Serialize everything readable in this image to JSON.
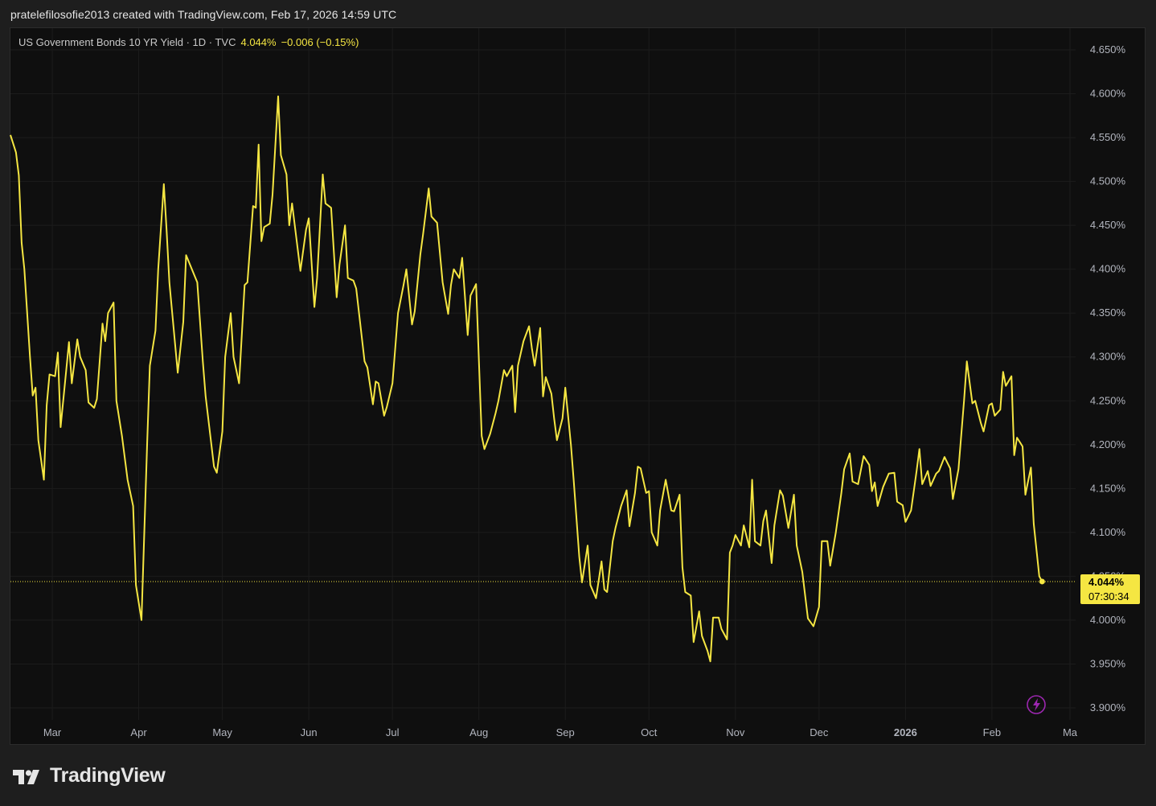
{
  "header": {
    "title": "pratelefilosofie2013 created with TradingView.com, Feb 17, 2026 14:59 UTC"
  },
  "legend": {
    "symbol": "US Government Bonds 10 YR Yield · 1D · TVC",
    "last": "4.044%",
    "change": "−0.006 (−0.15%)"
  },
  "price_label": {
    "value": "4.044%",
    "countdown": "07:30:34"
  },
  "footer": {
    "brand": "TradingView"
  },
  "colors": {
    "line": "#f5e642",
    "background": "#0f0f0f",
    "grid": "#1c1c1c",
    "label_bg": "#f5e642",
    "lightning": "#9c27b0"
  },
  "icons": {
    "lightning": "lightning-icon",
    "logo": "tradingview-logo-icon"
  },
  "chart_data": {
    "type": "line",
    "title": "US Government Bonds 10 YR Yield · 1D · TVC",
    "xlabel": "",
    "ylabel": "",
    "ylim": [
      3.88,
      4.66
    ],
    "y_ticks": [
      "4.650%",
      "4.600%",
      "4.550%",
      "4.500%",
      "4.450%",
      "4.400%",
      "4.350%",
      "4.300%",
      "4.250%",
      "4.200%",
      "4.150%",
      "4.100%",
      "4.050%",
      "4.000%",
      "3.950%",
      "3.900%"
    ],
    "y_tick_values": [
      4.65,
      4.6,
      4.55,
      4.5,
      4.45,
      4.4,
      4.35,
      4.3,
      4.25,
      4.2,
      4.15,
      4.1,
      4.05,
      4.0,
      3.95,
      3.9
    ],
    "x_ticks": [
      {
        "label": "Mar",
        "date": "2025-03-01",
        "bold": false
      },
      {
        "label": "Apr",
        "date": "2025-04-01",
        "bold": false
      },
      {
        "label": "May",
        "date": "2025-05-01",
        "bold": false
      },
      {
        "label": "Jun",
        "date": "2025-06-01",
        "bold": false
      },
      {
        "label": "Jul",
        "date": "2025-07-01",
        "bold": false
      },
      {
        "label": "Aug",
        "date": "2025-08-01",
        "bold": false
      },
      {
        "label": "Sep",
        "date": "2025-09-01",
        "bold": false
      },
      {
        "label": "Oct",
        "date": "2025-10-01",
        "bold": false
      },
      {
        "label": "Nov",
        "date": "2025-11-01",
        "bold": false
      },
      {
        "label": "Dec",
        "date": "2025-12-01",
        "bold": false
      },
      {
        "label": "2026",
        "date": "2026-01-01",
        "bold": true
      },
      {
        "label": "Feb",
        "date": "2026-02-01",
        "bold": false
      },
      {
        "label": "Ma",
        "date": "2026-03-01",
        "bold": false
      }
    ],
    "x_range": [
      "2025-02-14",
      "2026-03-01"
    ],
    "last_value": 4.044,
    "series": [
      {
        "values": [
          [
            "2025-02-14",
            4.553
          ],
          [
            "2025-02-16",
            4.533
          ],
          [
            "2025-02-17",
            4.507
          ],
          [
            "2025-02-18",
            4.43
          ],
          [
            "2025-02-19",
            4.4
          ],
          [
            "2025-02-21",
            4.3
          ],
          [
            "2025-02-22",
            4.256
          ],
          [
            "2025-02-23",
            4.265
          ],
          [
            "2025-02-24",
            4.205
          ],
          [
            "2025-02-26",
            4.16
          ],
          [
            "2025-02-27",
            4.245
          ],
          [
            "2025-02-28",
            4.28
          ],
          [
            "2025-03-02",
            4.278
          ],
          [
            "2025-03-03",
            4.305
          ],
          [
            "2025-03-04",
            4.22
          ],
          [
            "2025-03-06",
            4.285
          ],
          [
            "2025-03-07",
            4.317
          ],
          [
            "2025-03-08",
            4.27
          ],
          [
            "2025-03-10",
            4.32
          ],
          [
            "2025-03-11",
            4.3
          ],
          [
            "2025-03-13",
            4.285
          ],
          [
            "2025-03-14",
            4.248
          ],
          [
            "2025-03-16",
            4.242
          ],
          [
            "2025-03-17",
            4.252
          ],
          [
            "2025-03-19",
            4.338
          ],
          [
            "2025-03-20",
            4.318
          ],
          [
            "2025-03-21",
            4.35
          ],
          [
            "2025-03-23",
            4.362
          ],
          [
            "2025-03-24",
            4.25
          ],
          [
            "2025-03-26",
            4.21
          ],
          [
            "2025-03-28",
            4.16
          ],
          [
            "2025-03-30",
            4.13
          ],
          [
            "2025-03-31",
            4.04
          ],
          [
            "2025-04-02",
            4.0
          ],
          [
            "2025-04-04",
            4.2
          ],
          [
            "2025-04-05",
            4.29
          ],
          [
            "2025-04-07",
            4.33
          ],
          [
            "2025-04-08",
            4.4
          ],
          [
            "2025-04-10",
            4.497
          ],
          [
            "2025-04-11",
            4.445
          ],
          [
            "2025-04-12",
            4.385
          ],
          [
            "2025-04-15",
            4.282
          ],
          [
            "2025-04-17",
            4.34
          ],
          [
            "2025-04-18",
            4.416
          ],
          [
            "2025-04-22",
            4.385
          ],
          [
            "2025-04-24",
            4.295
          ],
          [
            "2025-04-25",
            4.255
          ],
          [
            "2025-04-28",
            4.175
          ],
          [
            "2025-04-29",
            4.168
          ],
          [
            "2025-05-01",
            4.215
          ],
          [
            "2025-05-02",
            4.3
          ],
          [
            "2025-05-04",
            4.35
          ],
          [
            "2025-05-05",
            4.3
          ],
          [
            "2025-05-07",
            4.27
          ],
          [
            "2025-05-09",
            4.382
          ],
          [
            "2025-05-10",
            4.385
          ],
          [
            "2025-05-12",
            4.472
          ],
          [
            "2025-05-13",
            4.47
          ],
          [
            "2025-05-14",
            4.542
          ],
          [
            "2025-05-15",
            4.432
          ],
          [
            "2025-05-16",
            4.448
          ],
          [
            "2025-05-18",
            4.452
          ],
          [
            "2025-05-19",
            4.485
          ],
          [
            "2025-05-21",
            4.597
          ],
          [
            "2025-05-22",
            4.53
          ],
          [
            "2025-05-24",
            4.508
          ],
          [
            "2025-05-25",
            4.45
          ],
          [
            "2025-05-26",
            4.475
          ],
          [
            "2025-05-29",
            4.398
          ],
          [
            "2025-05-31",
            4.445
          ],
          [
            "2025-06-01",
            4.458
          ],
          [
            "2025-06-03",
            4.357
          ],
          [
            "2025-06-04",
            4.39
          ],
          [
            "2025-06-06",
            4.508
          ],
          [
            "2025-06-07",
            4.475
          ],
          [
            "2025-06-09",
            4.47
          ],
          [
            "2025-06-11",
            4.368
          ],
          [
            "2025-06-12",
            4.405
          ],
          [
            "2025-06-14",
            4.45
          ],
          [
            "2025-06-15",
            4.39
          ],
          [
            "2025-06-17",
            4.387
          ],
          [
            "2025-06-18",
            4.378
          ],
          [
            "2025-06-21",
            4.295
          ],
          [
            "2025-06-22",
            4.288
          ],
          [
            "2025-06-24",
            4.246
          ],
          [
            "2025-06-25",
            4.272
          ],
          [
            "2025-06-26",
            4.27
          ],
          [
            "2025-06-28",
            4.233
          ],
          [
            "2025-06-29",
            4.243
          ],
          [
            "2025-07-01",
            4.27
          ],
          [
            "2025-07-03",
            4.35
          ],
          [
            "2025-07-05",
            4.382
          ],
          [
            "2025-07-06",
            4.4
          ],
          [
            "2025-07-08",
            4.337
          ],
          [
            "2025-07-09",
            4.352
          ],
          [
            "2025-07-11",
            4.417
          ],
          [
            "2025-07-12",
            4.44
          ],
          [
            "2025-07-14",
            4.492
          ],
          [
            "2025-07-15",
            4.46
          ],
          [
            "2025-07-17",
            4.453
          ],
          [
            "2025-07-19",
            4.385
          ],
          [
            "2025-07-21",
            4.349
          ],
          [
            "2025-07-22",
            4.382
          ],
          [
            "2025-07-23",
            4.4
          ],
          [
            "2025-07-25",
            4.39
          ],
          [
            "2025-07-26",
            4.413
          ],
          [
            "2025-07-28",
            4.325
          ],
          [
            "2025-07-29",
            4.37
          ],
          [
            "2025-07-31",
            4.383
          ],
          [
            "2025-08-02",
            4.21
          ],
          [
            "2025-08-03",
            4.195
          ],
          [
            "2025-08-05",
            4.212
          ],
          [
            "2025-08-07",
            4.236
          ],
          [
            "2025-08-08",
            4.25
          ],
          [
            "2025-08-10",
            4.285
          ],
          [
            "2025-08-11",
            4.278
          ],
          [
            "2025-08-13",
            4.29
          ],
          [
            "2025-08-14",
            4.237
          ],
          [
            "2025-08-15",
            4.29
          ],
          [
            "2025-08-17",
            4.318
          ],
          [
            "2025-08-19",
            4.335
          ],
          [
            "2025-08-20",
            4.31
          ],
          [
            "2025-08-21",
            4.29
          ],
          [
            "2025-08-23",
            4.333
          ],
          [
            "2025-08-24",
            4.255
          ],
          [
            "2025-08-25",
            4.277
          ],
          [
            "2025-08-27",
            4.258
          ],
          [
            "2025-08-28",
            4.23
          ],
          [
            "2025-08-29",
            4.205
          ],
          [
            "2025-08-31",
            4.23
          ],
          [
            "2025-09-01",
            4.265
          ],
          [
            "2025-09-03",
            4.2
          ],
          [
            "2025-09-04",
            4.16
          ],
          [
            "2025-09-06",
            4.072
          ],
          [
            "2025-09-07",
            4.043
          ],
          [
            "2025-09-09",
            4.085
          ],
          [
            "2025-09-10",
            4.04
          ],
          [
            "2025-09-12",
            4.025
          ],
          [
            "2025-09-14",
            4.067
          ],
          [
            "2025-09-15",
            4.035
          ],
          [
            "2025-09-16",
            4.032
          ],
          [
            "2025-09-18",
            4.09
          ],
          [
            "2025-09-19",
            4.105
          ],
          [
            "2025-09-21",
            4.13
          ],
          [
            "2025-09-23",
            4.148
          ],
          [
            "2025-09-24",
            4.107
          ],
          [
            "2025-09-26",
            4.145
          ],
          [
            "2025-09-27",
            4.175
          ],
          [
            "2025-09-28",
            4.173
          ],
          [
            "2025-09-30",
            4.145
          ],
          [
            "2025-10-01",
            4.147
          ],
          [
            "2025-10-02",
            4.1
          ],
          [
            "2025-10-04",
            4.085
          ],
          [
            "2025-10-05",
            4.125
          ],
          [
            "2025-10-07",
            4.16
          ],
          [
            "2025-10-09",
            4.125
          ],
          [
            "2025-10-10",
            4.124
          ],
          [
            "2025-10-12",
            4.143
          ],
          [
            "2025-10-13",
            4.06
          ],
          [
            "2025-10-14",
            4.032
          ],
          [
            "2025-10-16",
            4.028
          ],
          [
            "2025-10-17",
            3.975
          ],
          [
            "2025-10-19",
            4.01
          ],
          [
            "2025-10-20",
            3.982
          ],
          [
            "2025-10-22",
            3.965
          ],
          [
            "2025-10-23",
            3.953
          ],
          [
            "2025-10-24",
            4.003
          ],
          [
            "2025-10-26",
            4.003
          ],
          [
            "2025-10-27",
            3.99
          ],
          [
            "2025-10-29",
            3.978
          ],
          [
            "2025-10-30",
            4.077
          ],
          [
            "2025-10-31",
            4.085
          ],
          [
            "2025-11-01",
            4.097
          ],
          [
            "2025-11-03",
            4.085
          ],
          [
            "2025-11-04",
            4.108
          ],
          [
            "2025-11-06",
            4.083
          ],
          [
            "2025-11-07",
            4.16
          ],
          [
            "2025-11-08",
            4.09
          ],
          [
            "2025-11-10",
            4.085
          ],
          [
            "2025-11-11",
            4.113
          ],
          [
            "2025-11-12",
            4.125
          ],
          [
            "2025-11-14",
            4.065
          ],
          [
            "2025-11-15",
            4.108
          ],
          [
            "2025-11-17",
            4.148
          ],
          [
            "2025-11-18",
            4.142
          ],
          [
            "2025-11-20",
            4.105
          ],
          [
            "2025-11-22",
            4.143
          ],
          [
            "2025-11-23",
            4.085
          ],
          [
            "2025-11-25",
            4.055
          ],
          [
            "2025-11-27",
            4.002
          ],
          [
            "2025-11-29",
            3.993
          ],
          [
            "2025-12-01",
            4.015
          ],
          [
            "2025-12-02",
            4.09
          ],
          [
            "2025-12-04",
            4.09
          ],
          [
            "2025-12-05",
            4.062
          ],
          [
            "2025-12-07",
            4.1
          ],
          [
            "2025-12-09",
            4.145
          ],
          [
            "2025-12-10",
            4.172
          ],
          [
            "2025-12-12",
            4.19
          ],
          [
            "2025-12-13",
            4.158
          ],
          [
            "2025-12-15",
            4.155
          ],
          [
            "2025-12-17",
            4.187
          ],
          [
            "2025-12-19",
            4.177
          ],
          [
            "2025-12-20",
            4.147
          ],
          [
            "2025-12-21",
            4.157
          ],
          [
            "2025-12-22",
            4.13
          ],
          [
            "2025-12-24",
            4.152
          ],
          [
            "2025-12-26",
            4.167
          ],
          [
            "2025-12-28",
            4.168
          ],
          [
            "2025-12-29",
            4.135
          ],
          [
            "2025-12-31",
            4.131
          ],
          [
            "2026-01-01",
            4.112
          ],
          [
            "2026-01-03",
            4.125
          ],
          [
            "2026-01-05",
            4.17
          ],
          [
            "2026-01-06",
            4.195
          ],
          [
            "2026-01-07",
            4.155
          ],
          [
            "2026-01-09",
            4.17
          ],
          [
            "2026-01-10",
            4.153
          ],
          [
            "2026-01-12",
            4.167
          ],
          [
            "2026-01-13",
            4.17
          ],
          [
            "2026-01-15",
            4.186
          ],
          [
            "2026-01-17",
            4.173
          ],
          [
            "2026-01-18",
            4.138
          ],
          [
            "2026-01-20",
            4.172
          ],
          [
            "2026-01-22",
            4.25
          ],
          [
            "2026-01-23",
            4.295
          ],
          [
            "2026-01-25",
            4.247
          ],
          [
            "2026-01-26",
            4.25
          ],
          [
            "2026-01-28",
            4.225
          ],
          [
            "2026-01-29",
            4.215
          ],
          [
            "2026-01-31",
            4.245
          ],
          [
            "2026-02-01",
            4.247
          ],
          [
            "2026-02-02",
            4.233
          ],
          [
            "2026-02-04",
            4.24
          ],
          [
            "2026-02-05",
            4.283
          ],
          [
            "2026-02-06",
            4.267
          ],
          [
            "2026-02-08",
            4.278
          ],
          [
            "2026-02-09",
            4.188
          ],
          [
            "2026-02-10",
            4.208
          ],
          [
            "2026-02-12",
            4.198
          ],
          [
            "2026-02-13",
            4.143
          ],
          [
            "2026-02-15",
            4.174
          ],
          [
            "2026-02-16",
            4.11
          ],
          [
            "2026-02-18",
            4.05
          ],
          [
            "2026-02-19",
            4.044
          ]
        ]
      }
    ],
    "grid": true,
    "legend_position": "top-left",
    "current_price_line": "dotted"
  }
}
